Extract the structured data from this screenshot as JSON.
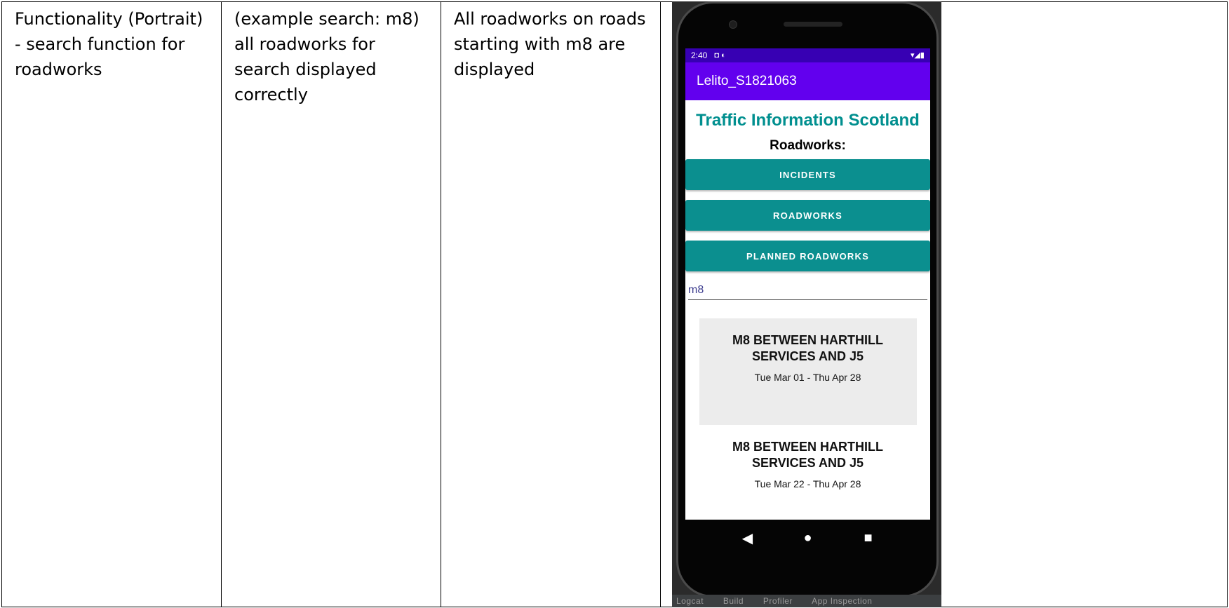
{
  "table": {
    "col1": "Functionality (Portrait) - search function for roadworks",
    "col2": "(example search: m8) all roadworks for search displayed correctly",
    "col3": "All roadworks on roads starting with m8 are displayed"
  },
  "phone": {
    "status": {
      "time": "2:40",
      "icons": "◘ ◐",
      "right": "▾◢▮"
    },
    "appbar_title": "Lelito_S1821063",
    "title": "Traffic Information Scotland",
    "section_heading": "Roadworks:",
    "buttons": {
      "incidents": "INCIDENTS",
      "roadworks": "ROADWORKS",
      "planned": "PLANNED ROADWORKS"
    },
    "search_value": "m8",
    "results": [
      {
        "title": "M8 BETWEEN HARTHILL SERVICES AND J5",
        "dates": "Tue Mar 01 - Thu Apr 28"
      },
      {
        "title": "M8 BETWEEN HARTHILL SERVICES AND J5",
        "dates": "Tue Mar 22 - Thu Apr 28"
      }
    ],
    "nav": {
      "back": "◀",
      "home": "●",
      "recents": "■"
    },
    "colors": {
      "primary": "#6200ee",
      "primary_dark": "#3700b3",
      "teal": "#0b8f8f"
    }
  },
  "ide_tabs": [
    "Logcat",
    "Build",
    "Profiler",
    "App Inspection"
  ]
}
